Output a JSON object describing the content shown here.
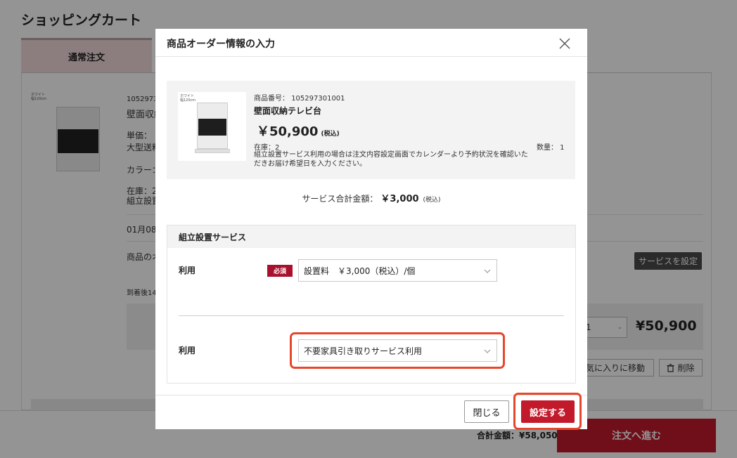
{
  "page": {
    "title": "ショッピングカート",
    "tab_active": "通常注文",
    "partial_texts": {
      "product_number": "1052973",
      "product_name": "壁面収納",
      "unit_price": "単価：",
      "shipping": "大型送料",
      "color": "カラー：",
      "stock": "在庫：2",
      "assembly": "組立設置",
      "date": "01月08",
      "product_note": "商品のオ",
      "delivery": "到着後14"
    },
    "service_button": "サービスを設定",
    "quantity_value": "1",
    "line_price": "¥50,900",
    "favorite_button": "お気に入りに移動",
    "delete_button": "削除",
    "total_label": "合計金額：¥58,050",
    "proceed_button": "注文へ進む",
    "thumb_tag": "ホワイト\n幅120cm"
  },
  "modal": {
    "title": "商品オーダー情報の入力",
    "product": {
      "number_label": "商品番号：",
      "number": "105297301001",
      "name": "壁面収納テレビ台",
      "price": "￥50,900",
      "tax": "(税込)",
      "stock": "在庫：2",
      "note": "組立設置サービス利用の場合は注文内容設定画面でカレンダーより予約状況を確認いただきお届け希望日を入力ください。",
      "quantity": "数量： 1",
      "image_tag": "ホワイト\n幅120cm"
    },
    "service_total": {
      "label": "サービス合計金額：",
      "amount": "￥3,000",
      "tax": "(税込)"
    },
    "section": {
      "title": "組立設置サービス",
      "row1_label": "利用",
      "required_badge": "必須",
      "row1_select": "設置料　￥3,000（税込）/個",
      "row2_label": "利用",
      "row2_select": "不要家具引き取りサービス利用"
    },
    "close_button": "閉じる",
    "set_button": "設定する"
  },
  "colors": {
    "accent": "#c2192b",
    "required_badge": "#a8112e",
    "highlight": "#e8462c",
    "tab_active_bg": "#f1dada"
  }
}
